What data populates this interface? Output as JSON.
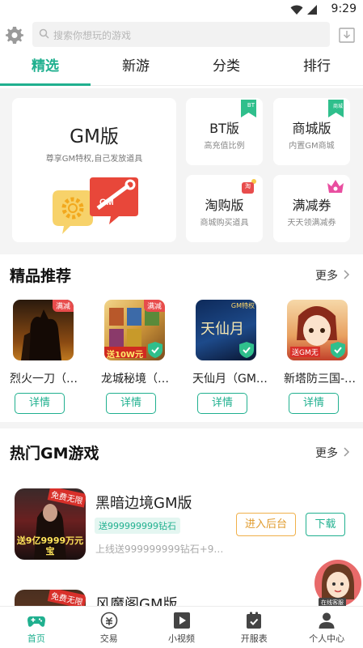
{
  "status_bar": {
    "time": "9:29"
  },
  "search": {
    "placeholder": "搜索你想玩的游戏"
  },
  "tabs": [
    {
      "label": "精选",
      "active": true
    },
    {
      "label": "新游",
      "active": false
    },
    {
      "label": "分类",
      "active": false
    },
    {
      "label": "排行",
      "active": false
    }
  ],
  "feature_cards": {
    "gm": {
      "title": "GM版",
      "subtitle": "尊享GM特权,自己发放道具",
      "logo_text": "GM"
    },
    "bt": {
      "title": "BT版",
      "subtitle": "高充值比例",
      "flag": "BT"
    },
    "store": {
      "title": "商城版",
      "subtitle": "内置GM商城",
      "flag": "商城"
    },
    "taobao": {
      "title": "淘购版",
      "subtitle": "商城购买道具",
      "flag": "淘"
    },
    "coupon": {
      "title": "满减券",
      "subtitle": "天天领满减券"
    }
  },
  "recommended": {
    "title": "精品推荐",
    "more": "更多",
    "games": [
      {
        "name": "烈火一刀（…",
        "tag": "满减",
        "button": "详情"
      },
      {
        "name": "龙城秘境（…",
        "tag": "满减",
        "button": "详情",
        "thumb_text": "送10W元"
      },
      {
        "name": "天仙月（GM…",
        "tag": "",
        "button": "详情",
        "thumb_text": "天仙月",
        "corner_text": "GM特权"
      },
      {
        "name": "新塔防三国-…",
        "tag": "",
        "button": "详情",
        "thumb_text": "送GM无"
      }
    ]
  },
  "hot_gm": {
    "title": "热门GM游戏",
    "more": "更多",
    "games": [
      {
        "name": "黑暗边境GM版",
        "badge": "送999999999钻石",
        "desc": "上线送999999999钻石+9…",
        "thumb_top": "免费无限",
        "thumb_bottom": "送9亿9999万元宝",
        "backend_button": "进入后台",
        "download_button": "下载"
      },
      {
        "name": "风魔阁GM版",
        "thumb_top": "免费无限"
      }
    ]
  },
  "customer_service": {
    "label": "在线客服"
  },
  "bottom_nav": [
    {
      "label": "首页",
      "icon": "gamepad-icon",
      "active": true
    },
    {
      "label": "交易",
      "icon": "trade-icon",
      "active": false
    },
    {
      "label": "小视频",
      "icon": "video-icon",
      "active": false
    },
    {
      "label": "开服表",
      "icon": "calendar-icon",
      "active": false
    },
    {
      "label": "个人中心",
      "icon": "user-icon",
      "active": false
    }
  ],
  "colors": {
    "accent": "#20b08f",
    "orange": "#e09a2b",
    "red": "#e84c4c"
  }
}
